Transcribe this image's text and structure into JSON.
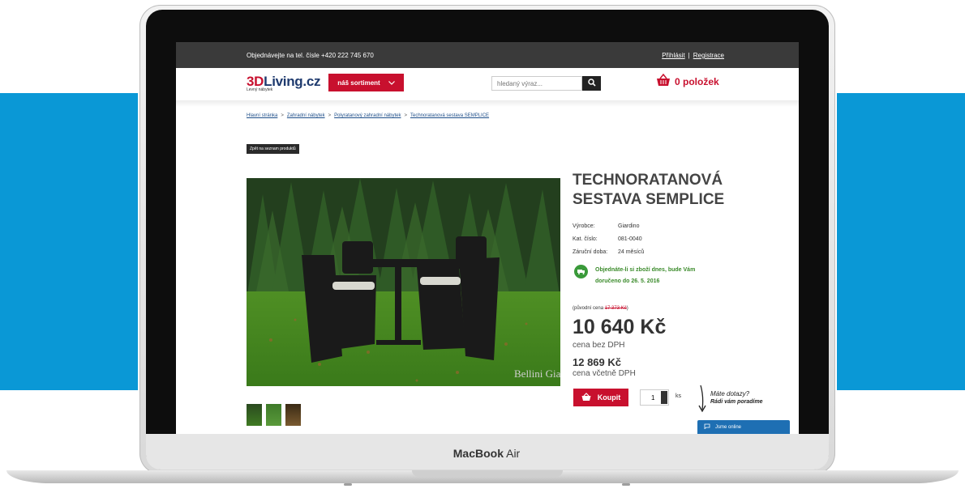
{
  "page": {
    "device_label_bold": "MacBook",
    "device_label_rest": "Air"
  },
  "topbar": {
    "phone_text": "Objednávejte na tel. čísle +420 222 745 670",
    "login": "Přihlásit",
    "separator": "|",
    "register": "Registrace"
  },
  "header": {
    "logo_prefix": "3D",
    "logo_main": "Living.cz",
    "logo_tagline": "Levný nábytek",
    "assortment_label": "náš sortiment",
    "search_placeholder": "hledaný výraz...",
    "cart_label": "0 položek"
  },
  "breadcrumb": {
    "items": [
      "Hlavní stránka",
      "Zahradní nábytek",
      "Polyratanový zahradní nábytek",
      "Technoratanová sestava SEMPLICE"
    ],
    "separator": ">"
  },
  "back_button": "Zpět na seznam produktů",
  "product": {
    "title_line1": "TECHNORATANOVÁ",
    "title_line2": "SESTAVA SEMPLICE",
    "specs": [
      {
        "key": "Výrobce:",
        "value": "Giardino"
      },
      {
        "key": "Kat. číslo:",
        "value": "081-0040"
      },
      {
        "key": "Záruční doba:",
        "value": "24 měsíců"
      }
    ],
    "delivery_text": "Objednáte-li si zboží dnes, bude Vám doručeno do",
    "delivery_date": "26. 5. 2016",
    "original_prefix": "(původní cena",
    "original_price": "17 373 Kč",
    "original_suffix": ")",
    "price": "10 640 Kč",
    "price_note": "cena bez DPH",
    "price_vat": "12 869 Kč",
    "price_vat_note": "cena včetně DPH",
    "image_watermark": "Bellini Giardino",
    "buy_label": "Koupit",
    "quantity": "1",
    "quantity_unit": "ks"
  },
  "help": {
    "line1": "Máte dotazy?",
    "line2": "Rádi vám poradíme"
  },
  "chat": {
    "label": "Jsme online"
  },
  "colors": {
    "brand_red": "#c8102e",
    "band_blue": "#0a98d6",
    "delivery_green": "#3a8a2a",
    "chat_blue": "#1e6fb3"
  }
}
